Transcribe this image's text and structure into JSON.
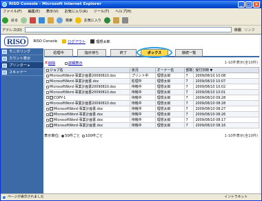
{
  "window": {
    "title": "RISO Console - Microsoft Internet Explorer"
  },
  "menu": [
    "ファイル(F)",
    "編集(E)",
    "表示(V)",
    "お気に入り(A)",
    "ツール(T)",
    "ヘルプ(H)"
  ],
  "toolbar": {
    "back": "戻る",
    "search": "検索",
    "favorites": "お気に入り"
  },
  "address": {
    "label": "アドレス(D)",
    "go": "移動",
    "links": "リンク"
  },
  "header": {
    "logo": "RISO",
    "console": "RISO Console",
    "logout": "ログアウト",
    "user": "理想太郎"
  },
  "sidebar": [
    {
      "label": "モニタリング"
    },
    {
      "label": "カウント表示"
    },
    {
      "label": "プリンター"
    },
    {
      "label": "スキャナー"
    }
  ],
  "tabs": [
    "処理中",
    "指示待ち",
    "終了",
    "ボックス",
    "接続一覧"
  ],
  "actions": {
    "delete": "削除",
    "detail": "詳細表示",
    "count": "1-10件表示(全10件)"
  },
  "columns": [
    "ジョブ名",
    "状況",
    "オーナー名",
    "部数",
    "受付日時 ▼"
  ],
  "rows": [
    [
      "MicrosoftWord-事業計画書20090810.doc",
      "プリント中",
      "理想太郎",
      "7",
      "2009/08/10 10:08"
    ],
    [
      "MicrosoftWord-事業計画書.doc",
      "処理中",
      "理想太郎",
      "7",
      "2009/08/10 10:07"
    ],
    [
      "MicrosoftWord-事業計画書20090810.doc",
      "待機中",
      "理想太郎",
      "7",
      "2009/08/10 10:02"
    ],
    [
      "MicrosoftWord-事業計画書20090810.doc",
      "待機中",
      "理想太郎",
      "7",
      "2009/08/10 10:01"
    ],
    [
      "COPY-1",
      "待機中",
      "理想太郎",
      "7",
      "2009/08/10 09:28"
    ],
    [
      "MicrosoftWord-事業計画書20090810.doc",
      "待機中",
      "理想太郎",
      "7",
      "2009/08/10 08:28"
    ],
    [
      "MicrosoftWord-事業計画書.doc",
      "待機中",
      "理想太郎",
      "7",
      "2009/08/10 08:27"
    ],
    [
      "MicrosoftWord-事業計画書.doc",
      "待機中",
      "理想太郎",
      "7",
      "2009/08/10 08:26"
    ],
    [
      "MicrosoftWord-事業計画書.doc",
      "待機中",
      "理想太郎",
      "7",
      "2009/08/10 08:17"
    ],
    [
      "MicrosoftWord-事業計画書.doc",
      "待機中",
      "理想太郎",
      "7",
      "2009/08/10 08:16"
    ]
  ],
  "footer": {
    "label": "表示単位:",
    "opt1": "50件ごと",
    "opt2": "100件ごと"
  },
  "status": {
    "left": "ページが表示されました",
    "right": "イントラネット"
  }
}
